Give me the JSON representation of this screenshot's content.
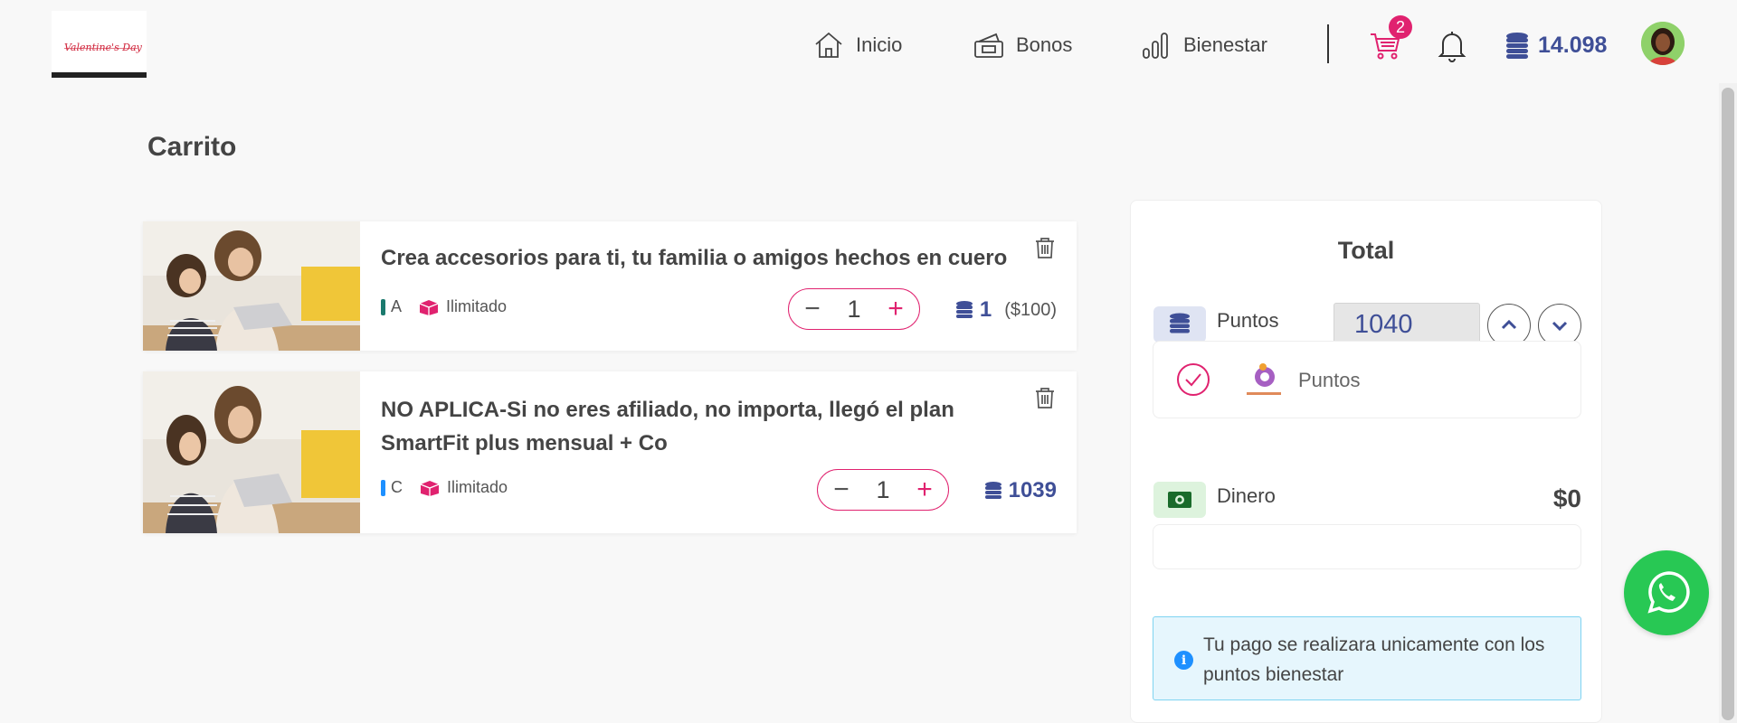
{
  "header": {
    "logo_text": "Valentine's Day",
    "nav": [
      {
        "label": "Inicio",
        "icon": "home-icon"
      },
      {
        "label": "Bonos",
        "icon": "ticket-icon"
      },
      {
        "label": "Bienestar",
        "icon": "bar-chart-icon"
      }
    ],
    "cart_count": "2",
    "points_total": "14.098"
  },
  "page": {
    "title": "Carrito"
  },
  "cart_items": [
    {
      "title": "Crea accesorios para ti, tu familia o amigos hechos en cuero",
      "category": "A",
      "category_color": "#1b7a6e",
      "stock": "Ilimitado",
      "quantity": "1",
      "points": "1",
      "money": "($100)"
    },
    {
      "title": "NO APLICA-Si no eres afiliado, no importa, llegó el plan SmartFit plus mensual + Co",
      "category": "C",
      "category_color": "#1e90ff",
      "stock": "Ilimitado",
      "quantity": "1",
      "points": "1039"
    }
  ],
  "summary": {
    "title": "Total",
    "points_label": "Puntos",
    "points_value": "1040",
    "method_label": "Puntos",
    "money_label": "Dinero",
    "money_value": "$0",
    "info_text": "Tu pago se realizara unicamente con los puntos bienestar"
  },
  "colors": {
    "accent": "#e0226f",
    "points": "#3f4f97",
    "whatsapp": "#28c854"
  }
}
